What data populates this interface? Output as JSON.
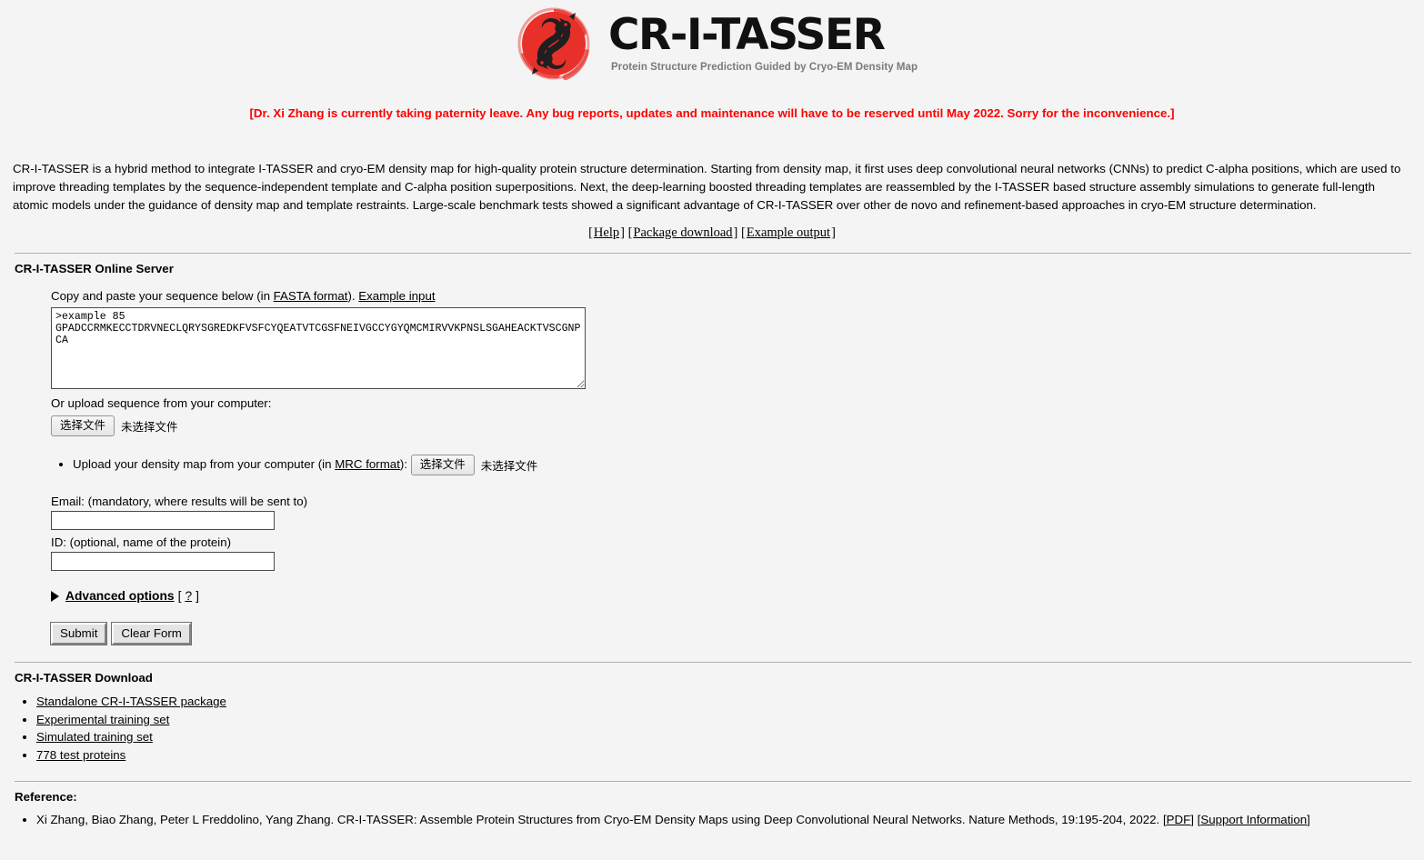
{
  "header": {
    "logo_icon": "koi-fish-circle-logo",
    "title": "CR-I-TASSER",
    "subtitle": "Protein Structure Prediction Guided by Cryo-EM Density Map",
    "logo_red": "#e8302a",
    "logo_dark": "#1f1f1f"
  },
  "notice": {
    "text": "[Dr. Xi Zhang is currently taking paternity leave. Any bug reports, updates and maintenance will have to be reserved until May 2022. Sorry for the inconvenience.]",
    "color": "#ff0000"
  },
  "description": {
    "text": "CR-I-TASSER is a hybrid method to integrate I-TASSER and cryo-EM density map for high-quality protein structure determination. Starting from density map, it first uses deep convolutional neural networks (CNNs) to predict C-alpha positions, which are used to improve threading templates by the sequence-independent template and C-alpha position superpositions. Next, the deep-learning boosted threading templates are reassembled by the I-TASSER based structure assembly simulations to generate full-length atomic models under the guidance of density map and template restraints. Large-scale benchmark tests showed a significant advantage of CR-I-TASSER over other de novo and refinement-based approaches in cryo-EM structure determination."
  },
  "top_links": {
    "help_open": "[",
    "help": "Help",
    "help_close": "]",
    "package_open": "[",
    "package": "Package download",
    "package_close": "]",
    "example_open": "[",
    "example": "Example output",
    "example_close": "]"
  },
  "server_section": {
    "title": "CR-I-TASSER Online Server",
    "sequence_label_pre": "Copy and paste your sequence below (in ",
    "fasta_link": "FASTA format",
    "sequence_label_post": "). ",
    "example_input_link": "Example input",
    "sequence_value": ">example 85\nGPADCCRMKECCTDRVNECLQRYSGREDKFVSFCYQEATVTCGSFNEIVGCCYGYQMCMIRVVKPNSLSGAHEACKTVSCGNP\nCA",
    "upload_seq_label": "Or upload sequence from your computer:",
    "file_button_label": "选择文件",
    "file_status_label": "未选择文件",
    "density_label_pre": "Upload your density map from your computer (in ",
    "mrc_link": "MRC format",
    "density_label_post": "):",
    "email_label": "Email: (mandatory, where results will be sent to)",
    "email_value": "",
    "email_placeholder": "",
    "id_label": "ID: (optional, name of the protein)",
    "id_value": "",
    "id_placeholder": "",
    "advanced_icon": "triangle-right-icon",
    "advanced_label": "Advanced options",
    "advanced_help_open": "[",
    "advanced_help": "?",
    "advanced_help_close": "]",
    "submit_label": "Submit",
    "clear_label": "Clear Form"
  },
  "download_section": {
    "title": "CR-I-TASSER Download",
    "items": [
      "Standalone CR-I-TASSER package",
      "Experimental training set",
      "Simulated training set",
      "778 test proteins"
    ]
  },
  "reference_section": {
    "title": "Reference:",
    "citation": "Xi Zhang, Biao Zhang, Peter L Freddolino, Yang Zhang. CR-I-TASSER: Assemble Protein Structures from Cryo-EM Density Maps using Deep Convolutional Neural Networks. Nature Methods, 19:195-204, 2022. ",
    "pdf_open": "[",
    "pdf": "PDF",
    "pdf_close": "] ",
    "support_open": "[",
    "support": "Support Information",
    "support_close": "]"
  }
}
